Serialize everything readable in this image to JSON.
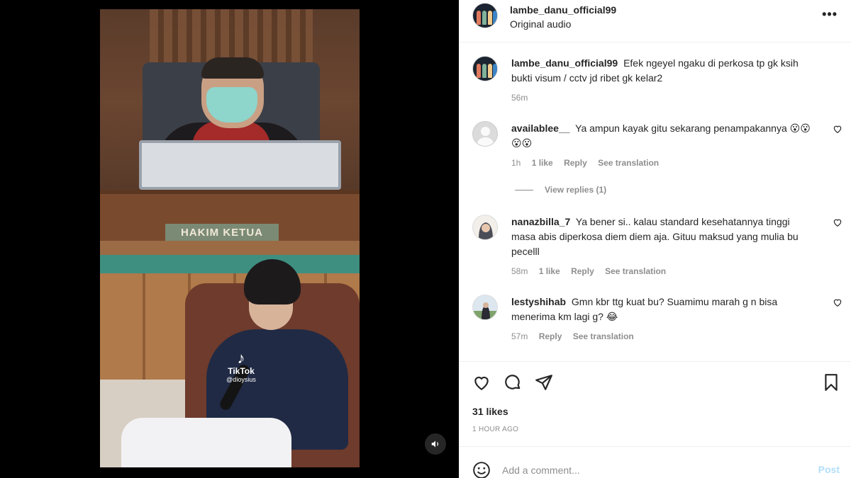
{
  "video": {
    "nameplate": "HAKIM KETUA",
    "watermark_brand": "TikTok",
    "watermark_user": "@dioysius"
  },
  "header": {
    "username": "lambe_danu_official99",
    "subtitle": "Original audio",
    "more_label": "•••"
  },
  "caption": {
    "username": "lambe_danu_official99",
    "text": "Efek ngeyel ngaku di perkosa tp gk ksih bukti visum / cctv jd ribet gk kelar2",
    "time": "56m"
  },
  "comments": [
    {
      "username": "availablee__",
      "text": "Ya ampun kayak gitu sekarang penampakannya 😮😮😮😮",
      "time": "1h",
      "likes": "1 like",
      "reply": "Reply",
      "translate": "See translation",
      "view_replies": "View replies (1)"
    },
    {
      "username": "nanazbilla_7",
      "text": "Ya bener si.. kalau standard kesehatannya tinggi masa abis diperkosa diem diem aja. Gituu maksud yang mulia bu pecelll",
      "time": "58m",
      "likes": "1 like",
      "reply": "Reply",
      "translate": "See translation"
    },
    {
      "username": "lestyshihab",
      "text": "Gmn kbr ttg kuat bu? Suamimu marah g n bisa menerima km lagi g? 😂",
      "time": "57m",
      "reply": "Reply",
      "translate": "See translation"
    }
  ],
  "actions": {
    "likes": "31 likes",
    "time_ago": "1 HOUR AGO"
  },
  "comment_box": {
    "placeholder": "Add a comment...",
    "post_label": "Post"
  },
  "colors": {
    "link_muted": "#8e8e8e",
    "post_disabled": "#b2dffc",
    "border": "#efefef"
  }
}
